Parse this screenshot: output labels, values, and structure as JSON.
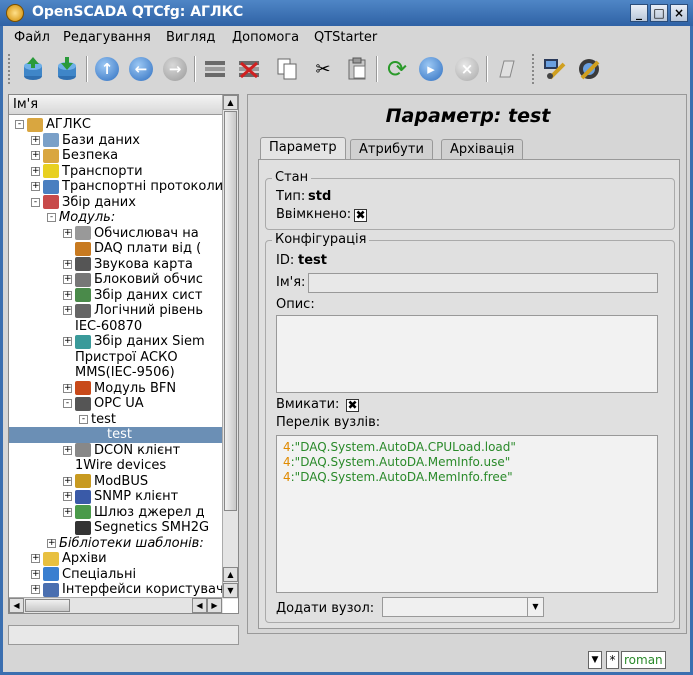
{
  "window": {
    "title": "OpenSCADA QTCfg: АГЛКС"
  },
  "menu": [
    "Файл",
    "Редагування",
    "Вигляд",
    "Допомога",
    "QTStarter"
  ],
  "toolbar_icons": [
    "db-load-icon",
    "db-save-icon",
    "up-icon",
    "back-icon",
    "forward-icon",
    "item-add-icon",
    "item-delete-icon",
    "copy-icon",
    "cut-icon",
    "paste-icon",
    "refresh-icon",
    "start-icon",
    "stop-icon",
    "info-icon",
    "user-icon",
    "settings-icon"
  ],
  "tree": {
    "header": "Ім'я",
    "items": [
      {
        "label": "АГЛКС",
        "depth": 0,
        "exp": "-",
        "italic": false,
        "color": "#d9a640"
      },
      {
        "label": "Бази даних",
        "depth": 1,
        "exp": "+",
        "italic": false,
        "color": "#7aa0c8"
      },
      {
        "label": "Безпека",
        "depth": 1,
        "exp": "+",
        "italic": false,
        "color": "#d9a640"
      },
      {
        "label": "Транспорти",
        "depth": 1,
        "exp": "+",
        "italic": false,
        "color": "#e8d020"
      },
      {
        "label": "Транспортні протоколи",
        "depth": 1,
        "exp": "+",
        "italic": false,
        "color": "#4a7fc0"
      },
      {
        "label": "Збір даних",
        "depth": 1,
        "exp": "-",
        "italic": false,
        "color": "#c84a4a"
      },
      {
        "label": "Модуль:",
        "depth": 2,
        "exp": "-",
        "italic": true,
        "color": ""
      },
      {
        "label": "Обчислювач на",
        "depth": 3,
        "exp": "+",
        "italic": false,
        "color": "#999999"
      },
      {
        "label": "DAQ плати від (",
        "depth": 3,
        "exp": "",
        "italic": false,
        "color": "#c87a20"
      },
      {
        "label": "Звукова карта",
        "depth": 3,
        "exp": "+",
        "italic": false,
        "color": "#555555"
      },
      {
        "label": "Блоковий обчис",
        "depth": 3,
        "exp": "+",
        "italic": false,
        "color": "#777777"
      },
      {
        "label": "Збір даних сист",
        "depth": 3,
        "exp": "+",
        "italic": false,
        "color": "#4a8a4a"
      },
      {
        "label": "Логічний рівень",
        "depth": 3,
        "exp": "+",
        "italic": false,
        "color": "#666666"
      },
      {
        "label": "IEC-60870",
        "depth": 3,
        "exp": "",
        "italic": false,
        "color": ""
      },
      {
        "label": "Збір даних Siem",
        "depth": 3,
        "exp": "+",
        "italic": false,
        "color": "#3a9a9a"
      },
      {
        "label": "Пристрої АСКО",
        "depth": 3,
        "exp": "",
        "italic": false,
        "color": ""
      },
      {
        "label": "MMS(IEC-9506)",
        "depth": 3,
        "exp": "",
        "italic": false,
        "color": ""
      },
      {
        "label": "Модуль BFN",
        "depth": 3,
        "exp": "+",
        "italic": false,
        "color": "#c84a1a"
      },
      {
        "label": "OPC UA",
        "depth": 3,
        "exp": "-",
        "italic": false,
        "color": "#555555"
      },
      {
        "label": "test",
        "depth": 4,
        "exp": "-",
        "italic": false,
        "color": ""
      },
      {
        "label": "test",
        "depth": 5,
        "exp": "",
        "italic": false,
        "color": "",
        "selected": true
      },
      {
        "label": "DCON клієнт",
        "depth": 3,
        "exp": "+",
        "italic": false,
        "color": "#888888"
      },
      {
        "label": "1Wire devices",
        "depth": 3,
        "exp": "",
        "italic": false,
        "color": ""
      },
      {
        "label": "ModBUS",
        "depth": 3,
        "exp": "+",
        "italic": false,
        "color": "#c89a20"
      },
      {
        "label": "SNMP клієнт",
        "depth": 3,
        "exp": "+",
        "italic": false,
        "color": "#3a5aa8"
      },
      {
        "label": "Шлюз джерел д",
        "depth": 3,
        "exp": "+",
        "italic": false,
        "color": "#4a9a4a"
      },
      {
        "label": "Segnetics SMH2G",
        "depth": 3,
        "exp": "",
        "italic": false,
        "color": "#333333"
      },
      {
        "label": "Бібліотеки шаблонів:",
        "depth": 2,
        "exp": "+",
        "italic": true,
        "color": ""
      },
      {
        "label": "Архіви",
        "depth": 1,
        "exp": "+",
        "italic": false,
        "color": "#e8c040"
      },
      {
        "label": "Спеціальні",
        "depth": 1,
        "exp": "+",
        "italic": false,
        "color": "#3a7fd0"
      },
      {
        "label": "Інтерфейси користувача",
        "depth": 1,
        "exp": "+",
        "italic": false,
        "color": "#4a6fb0"
      }
    ]
  },
  "page": {
    "title": "Параметр: test",
    "tabs": [
      "Параметр",
      "Атрибути",
      "Архівація"
    ],
    "state": {
      "legend": "Стан",
      "type_label": "Тип:",
      "type_value": "std",
      "enabled_label": "Ввімкнено:",
      "enabled_check": "✖"
    },
    "config": {
      "legend": "Конфігурація",
      "id_label": "ID:",
      "id_value": "test",
      "name_label": "Ім'я:",
      "name_value": "",
      "descr_label": "Опис:",
      "descr_value": "",
      "enable_label": "Вмикати:",
      "enable_check": "✖",
      "nodes_label": "Перелік вузлів:",
      "nodes": [
        {
          "num": "4",
          "str": ":\"DAQ.System.AutoDA.CPULoad.load\""
        },
        {
          "num": "4",
          "str": ":\"DAQ.System.AutoDA.MemInfo.use\""
        },
        {
          "num": "4",
          "str": ":\"DAQ.System.AutoDA.MemInfo.free\""
        }
      ],
      "add_node_label": "Додати вузол:",
      "add_node_value": ""
    }
  },
  "status": {
    "star": "*",
    "user": "roman"
  }
}
